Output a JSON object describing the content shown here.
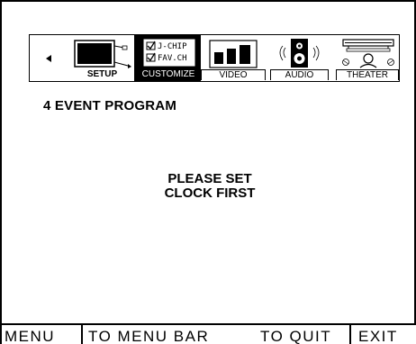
{
  "menu": {
    "tabs": [
      {
        "id": "setup",
        "label": "SETUP"
      },
      {
        "id": "customize",
        "label": "CUSTOMIZE",
        "icon_text_line1": "J-CHIP",
        "icon_text_line2": "FAV.CH"
      },
      {
        "id": "video",
        "label": "VIDEO"
      },
      {
        "id": "audio",
        "label": "AUDIO"
      },
      {
        "id": "theater",
        "label": "THEATER"
      }
    ],
    "selected_tab": "customize"
  },
  "section_title": "4 EVENT PROGRAM",
  "message": {
    "line1": "PLEASE SET",
    "line2": "CLOCK FIRST"
  },
  "help_bar": {
    "menu": "MENU",
    "to_menu_bar": "TO MENU BAR",
    "to_quit": "TO QUIT",
    "exit": "EXIT"
  },
  "colors": {
    "background": "#ffffff",
    "foreground": "#000000",
    "selected_tab": "#000000"
  },
  "icons": {
    "nav_left": "triangle-left-icon",
    "setup": "tv-screen-icon",
    "customize": "checklist-icon",
    "video": "picture-bars-icon",
    "audio": "speaker-icon",
    "theater": "projector-screen-icon"
  }
}
